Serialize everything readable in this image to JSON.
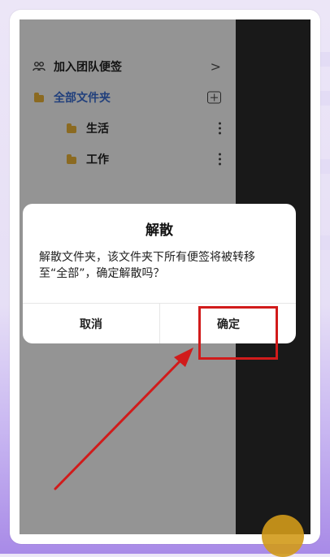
{
  "drawer": {
    "items": [
      {
        "label": "加入团队便签",
        "icon": "team-icon",
        "right": ">"
      },
      {
        "label": "全部文件夹",
        "icon": "folder-icon",
        "active": true,
        "right_icon": "add-folder-icon"
      },
      {
        "label": "生活",
        "icon": "folder-icon",
        "right_icon": "more-icon"
      },
      {
        "label": "工作",
        "icon": "folder-icon",
        "right_icon": "more-icon"
      }
    ]
  },
  "dialog": {
    "title": "解散",
    "message": "解散文件夹，该文件夹下所有便签将被转移至“全部”，确定解散吗？",
    "cancel_label": "取消",
    "confirm_label": "确定"
  },
  "colors": {
    "accent_blue": "#3b6fd6",
    "folder_yellow": "#f0b73a",
    "annotation_red": "#d11b1b"
  }
}
